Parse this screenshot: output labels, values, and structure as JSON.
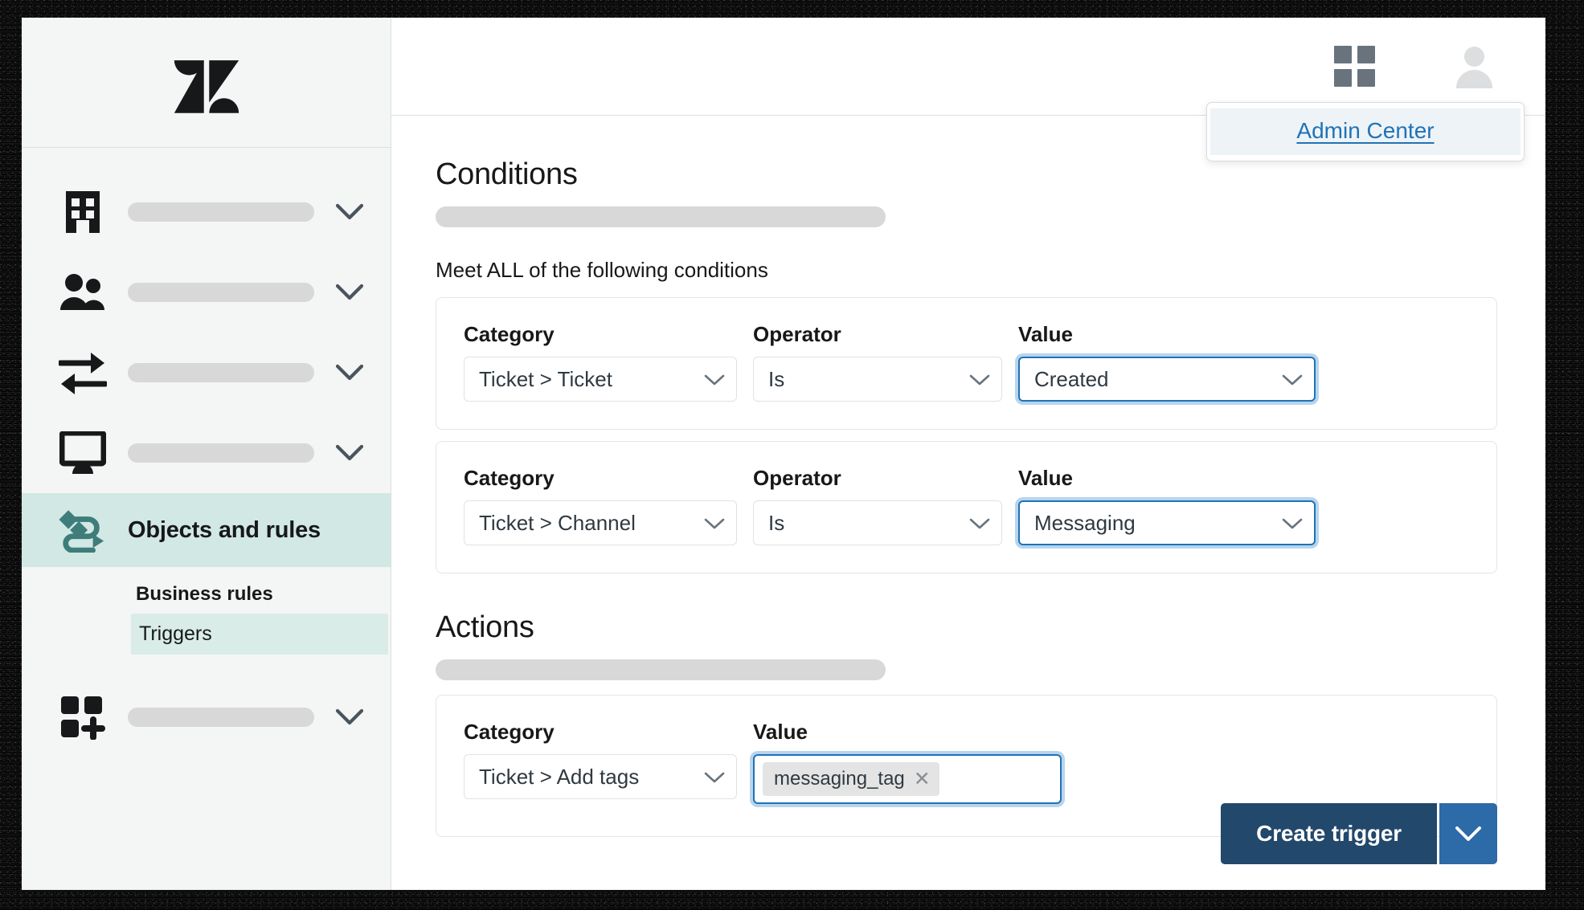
{
  "brand": {
    "logo_name": "zendesk-logo"
  },
  "topbar": {
    "products_icon": "grid-icon",
    "avatar_icon": "user-avatar-icon",
    "dropdown": {
      "items": [
        {
          "label": "Admin Center"
        }
      ]
    }
  },
  "sidebar": {
    "items": [
      {
        "icon": "building-icon",
        "label": "",
        "expandable": true
      },
      {
        "icon": "people-icon",
        "label": "",
        "expandable": true
      },
      {
        "icon": "transfer-arrows-icon",
        "label": "",
        "expandable": true
      },
      {
        "icon": "monitor-icon",
        "label": "",
        "expandable": true
      },
      {
        "icon": "objects-rules-icon",
        "label": "Objects and rules",
        "active": true
      },
      {
        "icon": "apps-add-icon",
        "label": "",
        "expandable": true
      }
    ],
    "subnav": {
      "group_label": "Business rules",
      "items": [
        {
          "label": "Triggers",
          "selected": true
        }
      ]
    }
  },
  "content": {
    "conditions": {
      "heading": "Conditions",
      "meet_label": "Meet ALL of the following conditions",
      "rows": [
        {
          "category_label": "Category",
          "category_value": "Ticket > Ticket",
          "operator_label": "Operator",
          "operator_value": "Is",
          "value_label": "Value",
          "value_value": "Created"
        },
        {
          "category_label": "Category",
          "category_value": "Ticket > Channel",
          "operator_label": "Operator",
          "operator_value": "Is",
          "value_label": "Value",
          "value_value": "Messaging"
        }
      ]
    },
    "actions": {
      "heading": "Actions",
      "row": {
        "category_label": "Category",
        "category_value": "Ticket > Add tags",
        "value_label": "Value",
        "tags": [
          {
            "text": "messaging_tag",
            "remove_icon": "close-icon"
          }
        ]
      }
    }
  },
  "footer": {
    "create_trigger_label": "Create trigger",
    "caret_icon": "chevron-down-icon"
  },
  "colors": {
    "accent_teal": "#d1e8e4",
    "link_blue": "#1f73b7",
    "primary_button": "#22486b",
    "primary_button_caret": "#2c6aa8",
    "sidebar_bg": "#f4f5f5",
    "placeholder_gray": "#d8d8d8"
  }
}
